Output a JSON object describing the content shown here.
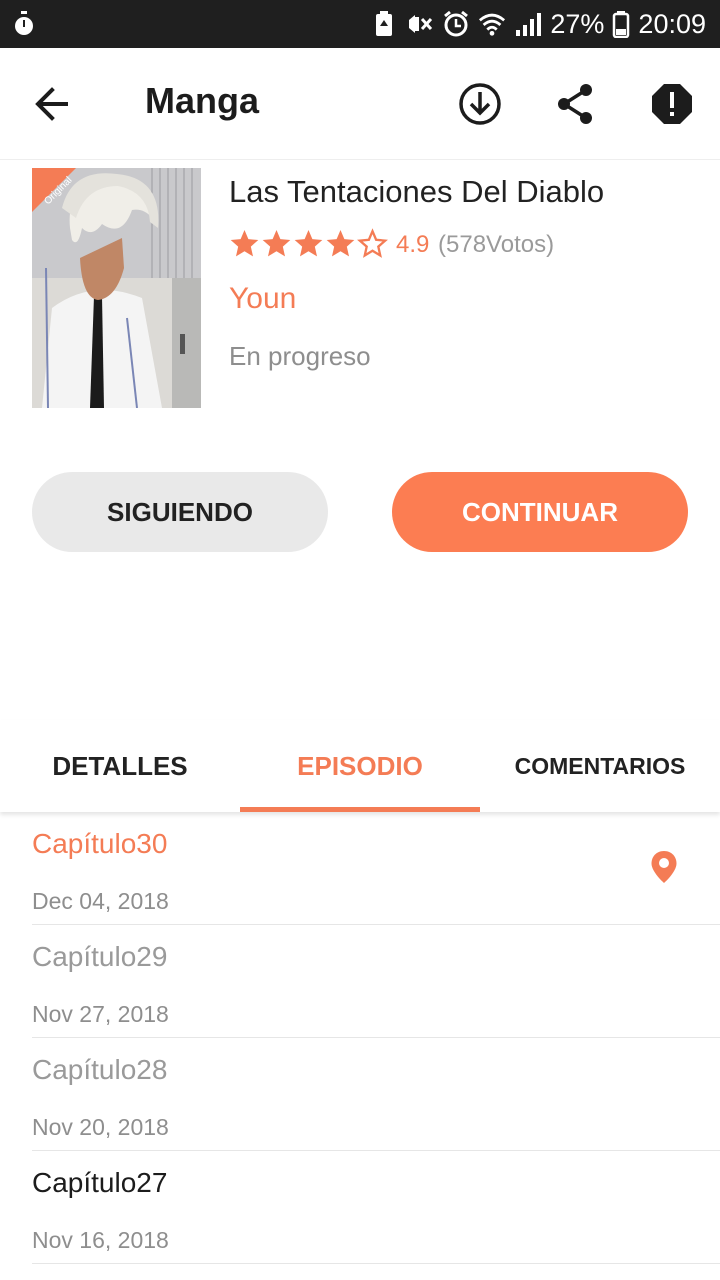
{
  "status_bar": {
    "battery": "27%",
    "time": "20:09",
    "icons": [
      "stopwatch-icon",
      "battery-saver-icon",
      "vibrate-off-icon",
      "alarm-icon",
      "wifi-icon",
      "signal-icon",
      "battery-icon"
    ]
  },
  "app_bar": {
    "title": "Manga",
    "icons": [
      "back-arrow-icon",
      "download-icon",
      "share-icon",
      "report-icon"
    ]
  },
  "manga": {
    "cover_badge": "Original",
    "title": "Las Tentaciones Del Diablo",
    "rating": "4.9",
    "rating_fraction": 0.9,
    "stars_filled": 4,
    "stars_total": 5,
    "votes": "(578Votos)",
    "author": "Youn",
    "status": "En progreso"
  },
  "actions": {
    "follow_label": "SIGUIENDO",
    "continue_label": "CONTINUAR"
  },
  "tabs": [
    {
      "label": "DETALLES",
      "active": false
    },
    {
      "label": "EPISODIO",
      "active": true
    },
    {
      "label": "COMENTARIOS",
      "active": false
    }
  ],
  "episodes": [
    {
      "name": "Capítulo30",
      "date": "Dec 04, 2018",
      "state": "current",
      "pin": true
    },
    {
      "name": "Capítulo29",
      "date": "Nov 27, 2018",
      "state": "read",
      "pin": false
    },
    {
      "name": "Capítulo28",
      "date": "Nov 20, 2018",
      "state": "read",
      "pin": false
    },
    {
      "name": "Capítulo27",
      "date": "Nov 16, 2018",
      "state": "unread",
      "pin": false
    }
  ],
  "colors": {
    "accent": "#f47c55",
    "button_accent": "#fc7d52",
    "status_bar_bg": "#1f1f1f",
    "read_text": "#9a9a9a",
    "unread_text": "#1c1c1c",
    "follow_bg": "#e9e9e9"
  }
}
